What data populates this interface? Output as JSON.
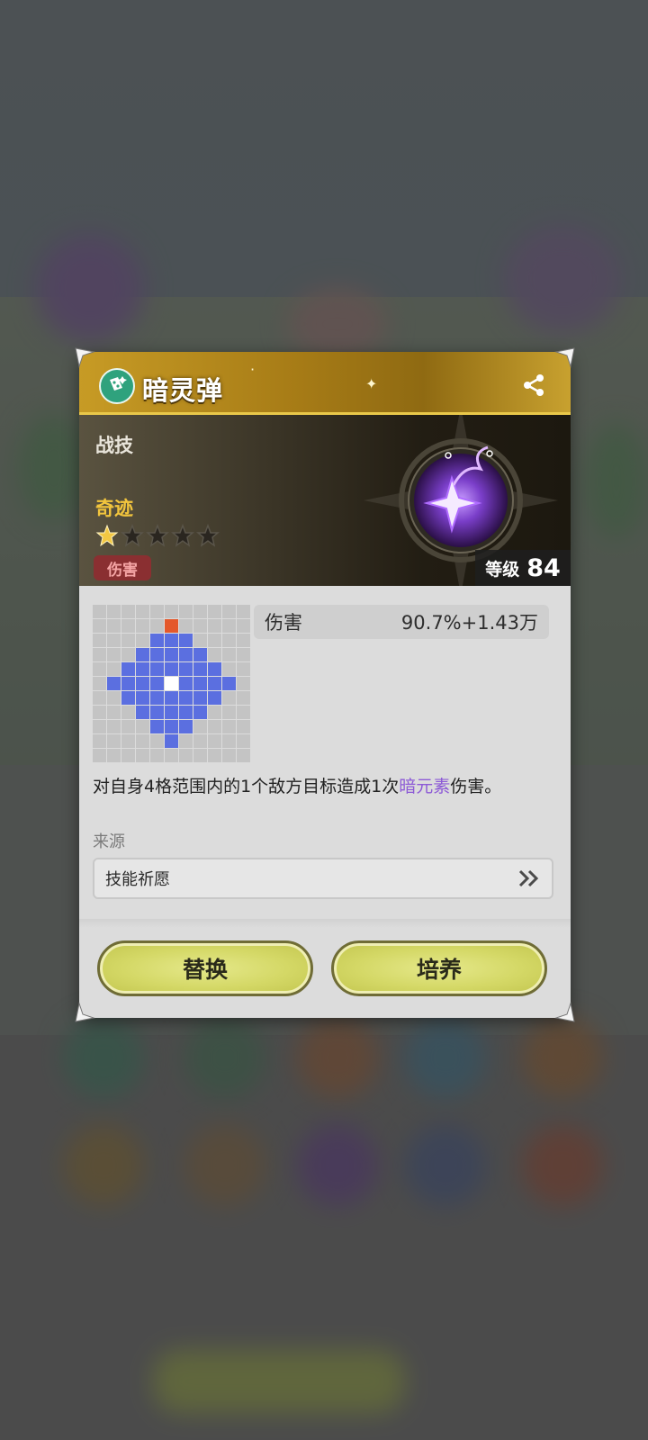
{
  "skill": {
    "name": "暗灵弹",
    "type": "战技",
    "rarity": "奇迹",
    "stars_filled": 1,
    "stars_total": 5,
    "tag": "伤害",
    "level_label": "等级",
    "level": "84"
  },
  "stat": {
    "label": "伤害",
    "value": "90.7%+1.43万"
  },
  "description": {
    "before": "对自身4格范围内的1个敌方目标造成1次",
    "highlight": "暗元素",
    "after": "伤害。"
  },
  "source": {
    "label": "来源",
    "value": "技能祈愿"
  },
  "buttons": {
    "replace": "替换",
    "train": "培养"
  },
  "colors": {
    "accent_gold": "#c79b25",
    "range_blue": "#5b6fe0",
    "target_orange": "#e4582b",
    "dark_element": "#8d5ad6"
  },
  "icons": {
    "skill_type": "dice-icon",
    "share": "share-icon",
    "more": "double-chevron-right-icon"
  }
}
